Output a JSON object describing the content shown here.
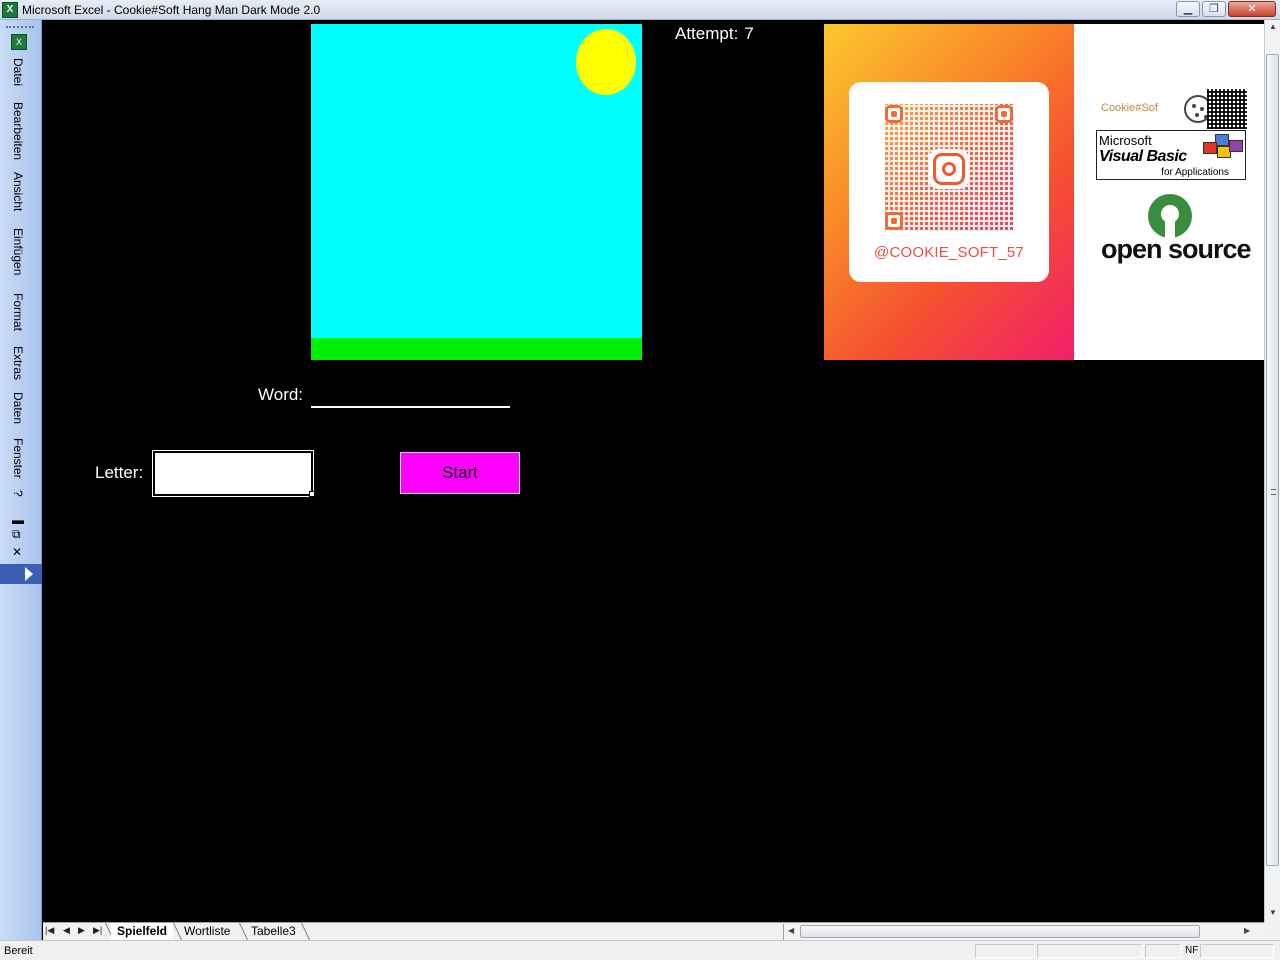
{
  "window": {
    "title": "Microsoft Excel - Cookie#Soft Hang Man Dark Mode 2.0",
    "app_icon": "X",
    "minimize": "▁",
    "maximize": "❐",
    "close": "✕"
  },
  "menu": {
    "items": [
      "Datei",
      "Bearbeiten",
      "Ansicht",
      "Einfügen",
      "Format",
      "Extras",
      "Daten",
      "Fenster",
      "?"
    ],
    "controls": {
      "minimize": "▬",
      "restore": "⧉",
      "close": "✕"
    }
  },
  "game": {
    "attempt_label": "Attempt:",
    "attempt_value": "7",
    "word_label": "Word:",
    "word_value": "",
    "letter_label": "Letter:",
    "letter_value": "",
    "start_label": "Start"
  },
  "promo": {
    "instagram_handle": "@COOKIE_SOFT_57",
    "cookie_soft_text": "Cookie#Sof",
    "vba_microsoft": "Microsoft",
    "vba_visual_basic": "Visual Basic",
    "vba_for_apps": "for Applications",
    "open_source": "open source"
  },
  "sheet_tabs": [
    {
      "label": "Spielfeld",
      "active": true
    },
    {
      "label": "Wortliste",
      "active": false
    },
    {
      "label": "Tabelle3",
      "active": false
    }
  ],
  "status": {
    "text": "Bereit",
    "nf": "NF"
  },
  "colors": {
    "sky": "#00ffff",
    "sun": "#ffff00",
    "ground": "#00ee00",
    "start_button": "#ff00ff",
    "background": "#000000"
  }
}
